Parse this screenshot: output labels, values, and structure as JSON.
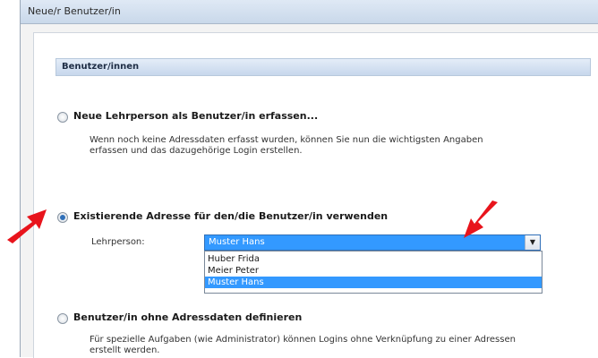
{
  "window": {
    "title": "Neue/r Benutzer/in"
  },
  "section": {
    "header": "Benutzer/innen"
  },
  "options": [
    {
      "label": "Neue Lehrperson als Benutzer/in erfassen...",
      "selected": false,
      "description_line1": "Wenn noch keine Adressdaten erfasst wurden, können Sie nun die wichtigsten Angaben",
      "description_line2": "erfassen und das dazugehörige Login erstellen."
    },
    {
      "label": "Existierende Adresse für den/die Benutzer/in verwenden",
      "selected": true
    },
    {
      "label": "Benutzer/in ohne Adressdaten definieren",
      "selected": false,
      "description_line1": "Für spezielle Aufgaben (wie Administrator) können Logins ohne Verknüpfung zu einer Adressen",
      "description_line2": "erstellt werden."
    }
  ],
  "lehrperson": {
    "label": "Lehrperson:",
    "value": "Muster Hans",
    "options": [
      "Huber Frida",
      "Meier Peter",
      "Muster Hans"
    ],
    "selected_index": 2
  },
  "colors": {
    "highlight": "#3399ff",
    "arrow": "#e8141c"
  },
  "icons": {
    "dropdown": "chevron-down-icon",
    "annotation": "red-arrow-icon"
  }
}
